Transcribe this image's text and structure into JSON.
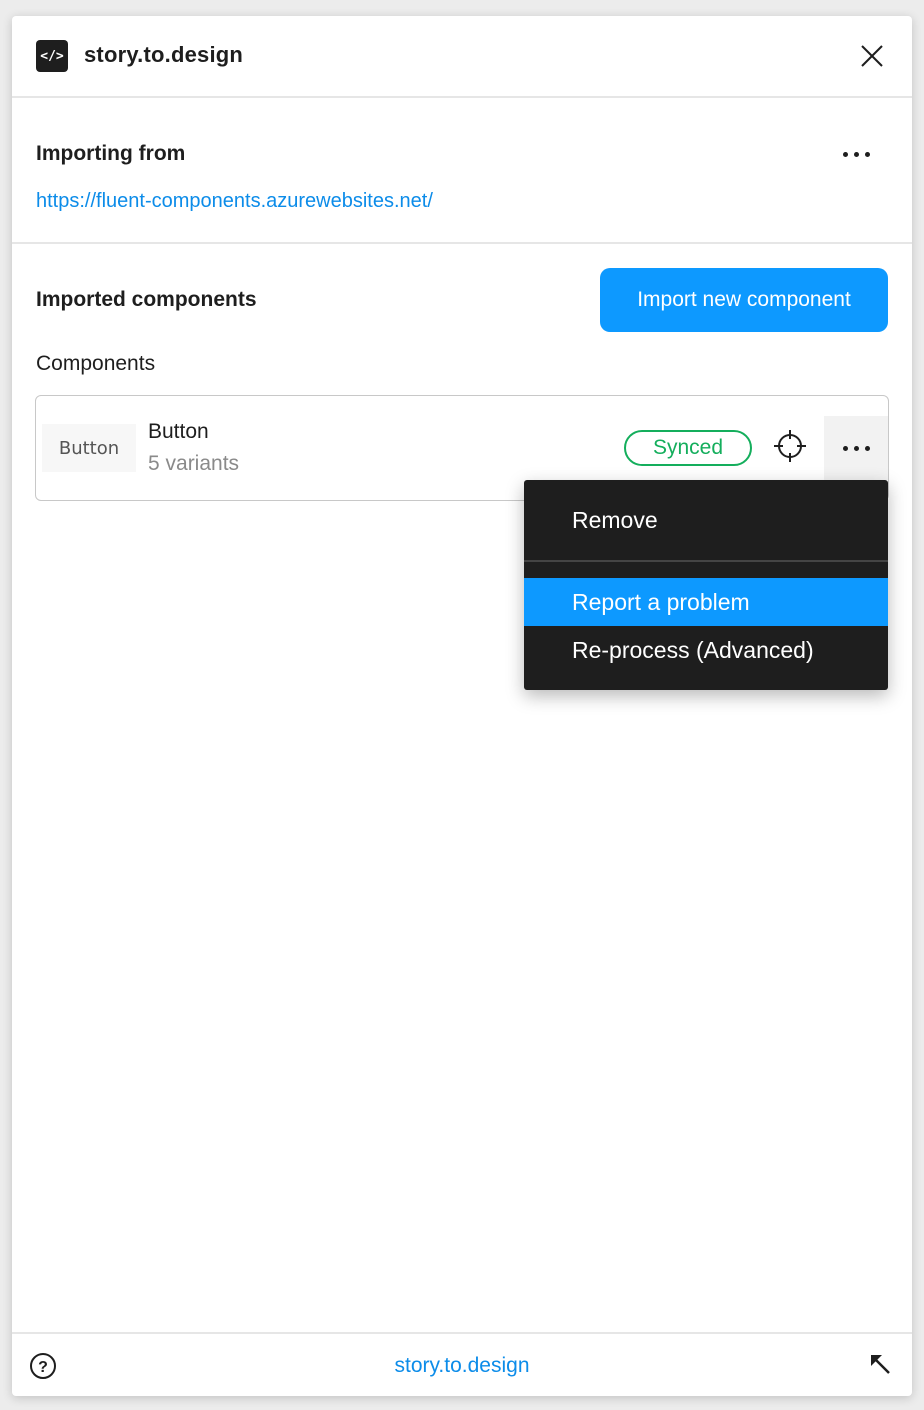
{
  "header": {
    "logo_glyph": "</>",
    "title": "story.to.design"
  },
  "source": {
    "label": "Importing from",
    "url": "https://fluent-components.azurewebsites.net/"
  },
  "components_section": {
    "title": "Imported components",
    "import_button": "Import new component",
    "list_label": "Components",
    "items": [
      {
        "thumbnail_text": "Button",
        "name": "Button",
        "variants": "5 variants",
        "status": "Synced"
      }
    ]
  },
  "context_menu": {
    "items": [
      {
        "label": "Remove",
        "highlighted": false
      },
      {
        "label": "Report a problem",
        "highlighted": true
      },
      {
        "label": "Re-process (Advanced)",
        "highlighted": false
      }
    ]
  },
  "footer": {
    "link": "story.to.design"
  },
  "colors": {
    "accent": "#0d99ff",
    "link": "#0c8ce9",
    "synced": "#14ae5c",
    "menu_bg": "#1e1e1e"
  }
}
